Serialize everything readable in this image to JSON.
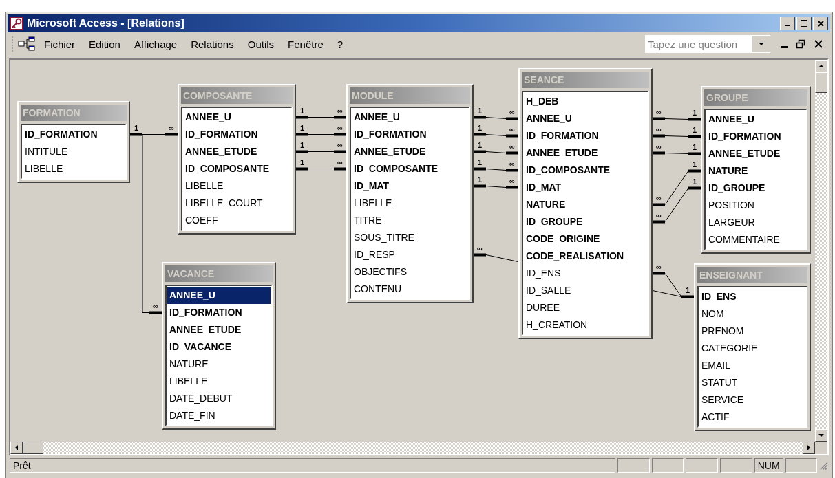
{
  "window": {
    "title": "Microsoft Access - [Relations]"
  },
  "menu": [
    {
      "label": "Fichier"
    },
    {
      "label": "Edition"
    },
    {
      "label": "Affichage"
    },
    {
      "label": "Relations"
    },
    {
      "label": "Outils"
    },
    {
      "label": "Fenêtre"
    },
    {
      "label": "?"
    }
  ],
  "search": {
    "placeholder": "Tapez une question"
  },
  "tables": [
    {
      "title": "FORMATION",
      "fields": [
        {
          "name": "ID_FORMATION",
          "key": true,
          "selected": false
        },
        {
          "name": "INTITULE",
          "key": false,
          "selected": false
        },
        {
          "name": "LIBELLE",
          "key": false,
          "selected": false
        }
      ]
    },
    {
      "title": "COMPOSANTE",
      "fields": [
        {
          "name": "ANNEE_U",
          "key": true,
          "selected": false
        },
        {
          "name": "ID_FORMATION",
          "key": true,
          "selected": false
        },
        {
          "name": "ANNEE_ETUDE",
          "key": true,
          "selected": false
        },
        {
          "name": "ID_COMPOSANTE",
          "key": true,
          "selected": false
        },
        {
          "name": "LIBELLE",
          "key": false,
          "selected": false
        },
        {
          "name": "LIBELLE_COURT",
          "key": false,
          "selected": false
        },
        {
          "name": "COEFF",
          "key": false,
          "selected": false
        }
      ]
    },
    {
      "title": "MODULE",
      "fields": [
        {
          "name": "ANNEE_U",
          "key": true,
          "selected": false
        },
        {
          "name": "ID_FORMATION",
          "key": true,
          "selected": false
        },
        {
          "name": "ANNEE_ETUDE",
          "key": true,
          "selected": false
        },
        {
          "name": "ID_COMPOSANTE",
          "key": true,
          "selected": false
        },
        {
          "name": "ID_MAT",
          "key": true,
          "selected": false
        },
        {
          "name": "LIBELLE",
          "key": false,
          "selected": false
        },
        {
          "name": "TITRE",
          "key": false,
          "selected": false
        },
        {
          "name": "SOUS_TITRE",
          "key": false,
          "selected": false
        },
        {
          "name": "ID_RESP",
          "key": false,
          "selected": false
        },
        {
          "name": "OBJECTIFS",
          "key": false,
          "selected": false
        },
        {
          "name": "CONTENU",
          "key": false,
          "selected": false
        }
      ]
    },
    {
      "title": "SEANCE",
      "fields": [
        {
          "name": "H_DEB",
          "key": true,
          "selected": false
        },
        {
          "name": "ANNEE_U",
          "key": true,
          "selected": false
        },
        {
          "name": "ID_FORMATION",
          "key": true,
          "selected": false
        },
        {
          "name": "ANNEE_ETUDE",
          "key": true,
          "selected": false
        },
        {
          "name": "ID_COMPOSANTE",
          "key": true,
          "selected": false
        },
        {
          "name": "ID_MAT",
          "key": true,
          "selected": false
        },
        {
          "name": "NATURE",
          "key": true,
          "selected": false
        },
        {
          "name": "ID_GROUPE",
          "key": true,
          "selected": false
        },
        {
          "name": "CODE_ORIGINE",
          "key": true,
          "selected": false
        },
        {
          "name": "CODE_REALISATION",
          "key": true,
          "selected": false
        },
        {
          "name": "ID_ENS",
          "key": false,
          "selected": false
        },
        {
          "name": "ID_SALLE",
          "key": false,
          "selected": false
        },
        {
          "name": "DUREE",
          "key": false,
          "selected": false
        },
        {
          "name": "H_CREATION",
          "key": false,
          "selected": false
        }
      ]
    },
    {
      "title": "GROUPE",
      "fields": [
        {
          "name": "ANNEE_U",
          "key": true,
          "selected": false
        },
        {
          "name": "ID_FORMATION",
          "key": true,
          "selected": false
        },
        {
          "name": "ANNEE_ETUDE",
          "key": true,
          "selected": false
        },
        {
          "name": "NATURE",
          "key": true,
          "selected": false
        },
        {
          "name": "ID_GROUPE",
          "key": true,
          "selected": false
        },
        {
          "name": "POSITION",
          "key": false,
          "selected": false
        },
        {
          "name": "LARGEUR",
          "key": false,
          "selected": false
        },
        {
          "name": "COMMENTAIRE",
          "key": false,
          "selected": false
        }
      ]
    },
    {
      "title": "VACANCE",
      "fields": [
        {
          "name": "ANNEE_U",
          "key": true,
          "selected": true
        },
        {
          "name": "ID_FORMATION",
          "key": true,
          "selected": false
        },
        {
          "name": "ANNEE_ETUDE",
          "key": true,
          "selected": false
        },
        {
          "name": "ID_VACANCE",
          "key": true,
          "selected": false
        },
        {
          "name": "NATURE",
          "key": false,
          "selected": false
        },
        {
          "name": "LIBELLE",
          "key": false,
          "selected": false
        },
        {
          "name": "DATE_DEBUT",
          "key": false,
          "selected": false
        },
        {
          "name": "DATE_FIN",
          "key": false,
          "selected": false
        }
      ]
    },
    {
      "title": "ENSEIGNANT",
      "fields": [
        {
          "name": "ID_ENS",
          "key": true,
          "selected": false
        },
        {
          "name": "NOM",
          "key": false,
          "selected": false
        },
        {
          "name": "PRENOM",
          "key": false,
          "selected": false
        },
        {
          "name": "CATEGORIE",
          "key": false,
          "selected": false
        },
        {
          "name": "EMAIL",
          "key": false,
          "selected": false
        },
        {
          "name": "STATUT",
          "key": false,
          "selected": false
        },
        {
          "name": "SERVICE",
          "key": false,
          "selected": false
        },
        {
          "name": "ACTIF",
          "key": false,
          "selected": false
        }
      ]
    }
  ],
  "relations": [
    {
      "left_label": "1",
      "right_label": "∞"
    },
    {
      "right_label": "∞"
    },
    {
      "left_label": "1",
      "right_label": "∞"
    },
    {
      "left_label": "1",
      "right_label": "∞"
    },
    {
      "left_label": "1",
      "right_label": "∞"
    },
    {
      "left_label": "1",
      "right_label": "∞"
    },
    {
      "left_label": "1",
      "right_label": "∞"
    },
    {
      "left_label": "1",
      "right_label": "∞"
    },
    {
      "left_label": "1",
      "right_label": "∞"
    },
    {
      "left_label": "1",
      "right_label": "∞"
    },
    {
      "left_label": "1",
      "right_label": "∞"
    },
    {
      "left_label": "∞",
      "right_label": "1"
    },
    {
      "left_label": "∞",
      "right_label": "1"
    },
    {
      "left_label": "∞",
      "right_label": "1"
    },
    {
      "left_label": "∞",
      "right_label": "1"
    },
    {
      "left_label": "∞",
      "right_label": "1"
    },
    {
      "left_label": "∞",
      "right_label": "1"
    },
    {
      "left_label": "∞"
    }
  ],
  "status_bar": {
    "message": "Prêt",
    "indicator": "NUM"
  }
}
